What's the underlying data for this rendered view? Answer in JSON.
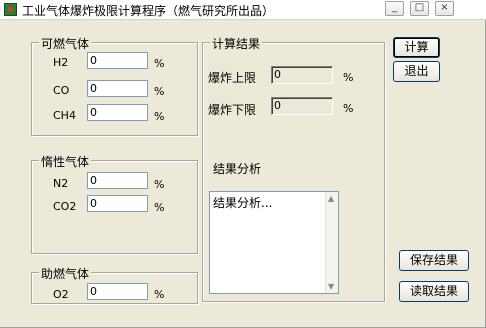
{
  "window": {
    "title": "工业气体爆炸极限计算程序（燃气研究所出品）"
  },
  "titlebar_buttons": {
    "minimize": "_",
    "maximize": "□",
    "close": "×"
  },
  "flammable": {
    "legend": "可燃气体",
    "rows": [
      {
        "label": "H2",
        "value": "0",
        "unit": "%"
      },
      {
        "label": "CO",
        "value": "0",
        "unit": "%"
      },
      {
        "label": "CH4",
        "value": "0",
        "unit": "%"
      }
    ]
  },
  "inert": {
    "legend": "惰性气体",
    "rows": [
      {
        "label": "N2",
        "value": "0",
        "unit": "%"
      },
      {
        "label": "CO2",
        "value": "0",
        "unit": "%"
      }
    ]
  },
  "oxidant": {
    "legend": "助燃气体",
    "rows": [
      {
        "label": "O2",
        "value": "0",
        "unit": "%"
      }
    ]
  },
  "results": {
    "legend": "计算结果",
    "upper_label": "爆炸上限",
    "upper_value": "0",
    "upper_unit": "%",
    "lower_label": "爆炸下限",
    "lower_value": "0",
    "lower_unit": "%",
    "analysis_label": "结果分析",
    "analysis_text": "结果分析..."
  },
  "buttons": {
    "calculate": "计算",
    "exit": "退出",
    "save": "保存结果",
    "load": "读取结果"
  }
}
